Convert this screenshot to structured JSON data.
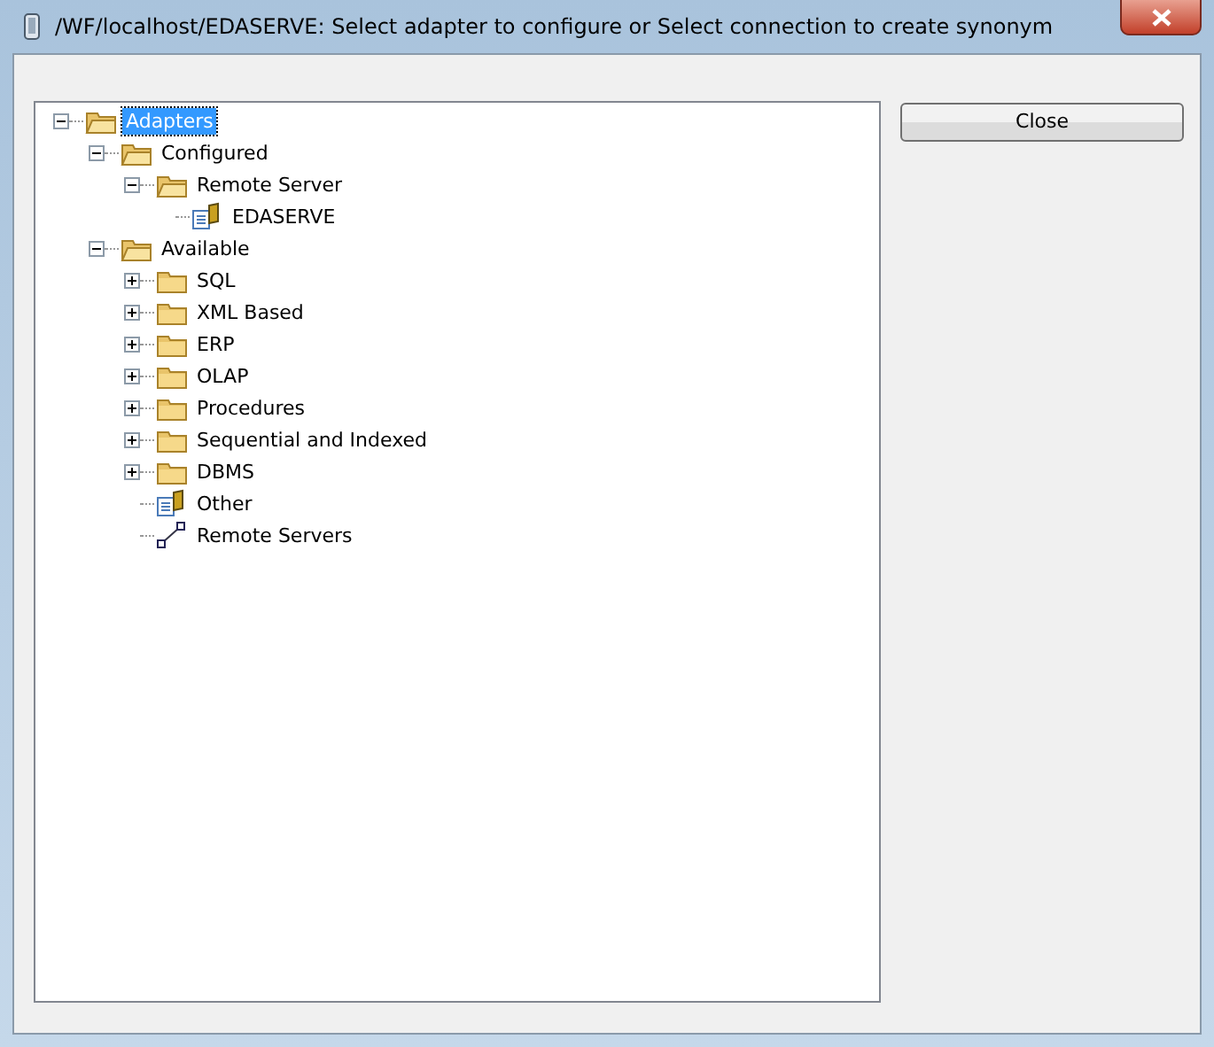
{
  "window": {
    "title": "/WF/localhost/EDASERVE: Select adapter to configure or Select connection to create synonym"
  },
  "tree": [
    {
      "label": "Adapters",
      "kind": "folder",
      "expanded": true,
      "selected": true,
      "children": [
        {
          "label": "Configured",
          "kind": "folder",
          "expanded": true,
          "selected": false,
          "children": [
            {
              "label": "Remote Server",
              "kind": "folder",
              "expanded": true,
              "selected": false,
              "children": [
                {
                  "label": "EDASERVE",
                  "kind": "adapter",
                  "selected": false
                }
              ]
            }
          ]
        },
        {
          "label": "Available",
          "kind": "folder",
          "expanded": true,
          "selected": false,
          "children": [
            {
              "label": "SQL",
              "kind": "folder",
              "expanded": false,
              "selected": false
            },
            {
              "label": "XML Based",
              "kind": "folder",
              "expanded": false,
              "selected": false
            },
            {
              "label": "ERP",
              "kind": "folder",
              "expanded": false,
              "selected": false
            },
            {
              "label": "OLAP",
              "kind": "folder",
              "expanded": false,
              "selected": false
            },
            {
              "label": "Procedures",
              "kind": "folder",
              "expanded": false,
              "selected": false
            },
            {
              "label": "Sequential and Indexed",
              "kind": "folder",
              "expanded": false,
              "selected": false
            },
            {
              "label": "DBMS",
              "kind": "folder",
              "expanded": false,
              "selected": false
            },
            {
              "label": "Other",
              "kind": "adapter",
              "selected": false
            },
            {
              "label": "Remote Servers",
              "kind": "connection",
              "selected": false
            }
          ]
        }
      ]
    }
  ],
  "buttons": [
    {
      "label": "Close"
    }
  ]
}
